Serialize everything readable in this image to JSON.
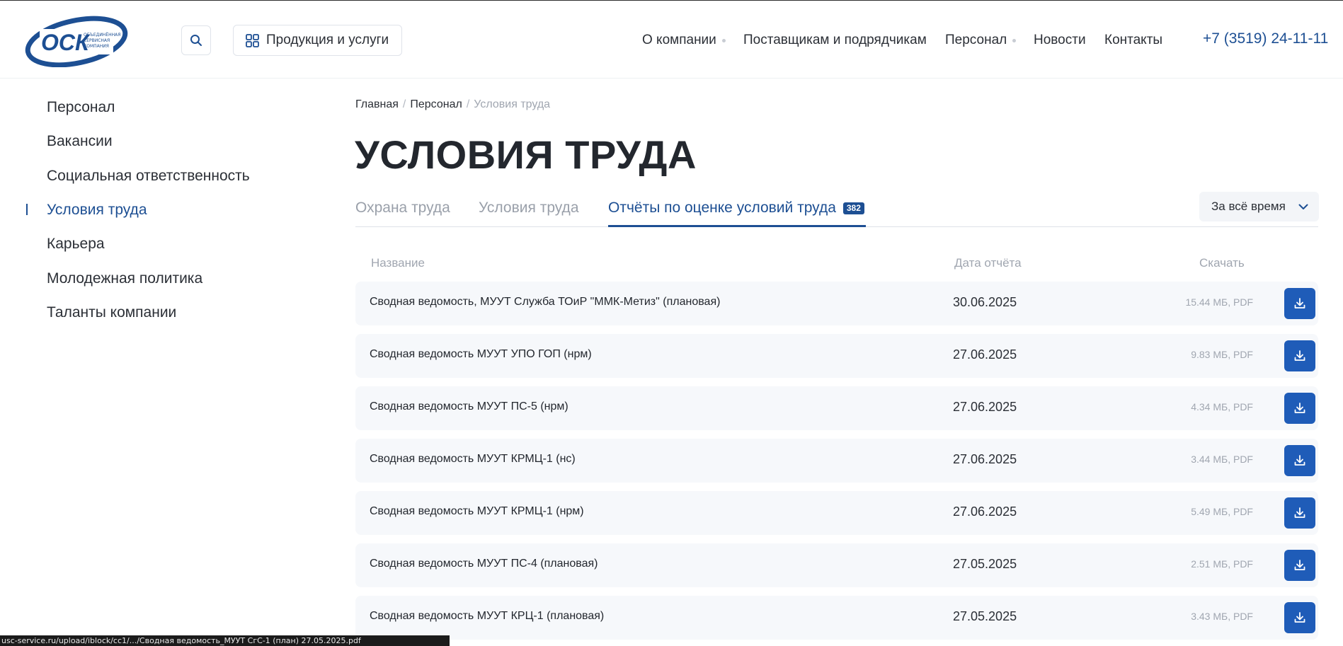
{
  "logo": {
    "abbr": "ОСК",
    "line1": "ОБЪЕДИНЁННАЯ",
    "line2": "СЕРВИСНАЯ",
    "line3": "КОМПАНИЯ",
    "brand_color": "#1d4f93"
  },
  "header": {
    "search_icon": "search-icon",
    "products_label": "Продукция и услуги",
    "products_icon": "grid-icon",
    "nav": [
      {
        "label": "О компании",
        "has_dropdown": true
      },
      {
        "label": "Поставщикам и подрядчикам",
        "has_dropdown": false
      },
      {
        "label": "Персонал",
        "has_dropdown": true
      },
      {
        "label": "Новости",
        "has_dropdown": false
      },
      {
        "label": "Контакты",
        "has_dropdown": false
      }
    ],
    "phone": "+7 (3519) 24-11-11"
  },
  "sidebar": {
    "items": [
      {
        "label": "Персонал",
        "active": false
      },
      {
        "label": "Вакансии",
        "active": false
      },
      {
        "label": "Социальная ответственность",
        "active": false
      },
      {
        "label": "Условия труда",
        "active": true
      },
      {
        "label": "Карьера",
        "active": false
      },
      {
        "label": "Молодежная политика",
        "active": false
      },
      {
        "label": "Таланты компании",
        "active": false
      }
    ]
  },
  "breadcrumb": {
    "items": [
      "Главная",
      "Персонал"
    ],
    "current": "Условия труда",
    "separator": "/"
  },
  "page_title": "УСЛОВИЯ ТРУДА",
  "tabs": [
    {
      "label": "Охрана труда",
      "active": false
    },
    {
      "label": "Условия труда",
      "active": false
    },
    {
      "label": "Отчёты по оценке условий труда",
      "active": true,
      "badge": "382"
    }
  ],
  "period_filter": {
    "value": "За всё время",
    "icon": "chevron-down-icon"
  },
  "table": {
    "columns": {
      "name": "Название",
      "date": "Дата отчёта",
      "download": "Скачать"
    },
    "rows": [
      {
        "name": "Сводная ведомость, МУУТ Служба ТОиР \"ММК-Метиз\" (плановая)",
        "date": "30.06.2025",
        "size": "15.44 МБ, PDF"
      },
      {
        "name": "Сводная ведомость МУУТ УПО ГОП (нрм)",
        "date": "27.06.2025",
        "size": "9.83 МБ, PDF"
      },
      {
        "name": "Сводная ведомость МУУТ ПС-5 (нрм)",
        "date": "27.06.2025",
        "size": "4.34 МБ, PDF"
      },
      {
        "name": "Сводная ведомость МУУТ КРМЦ-1 (нс)",
        "date": "27.06.2025",
        "size": "3.44 МБ, PDF"
      },
      {
        "name": "Сводная ведомость МУУТ КРМЦ-1 (нрм)",
        "date": "27.06.2025",
        "size": "5.49 МБ, PDF"
      },
      {
        "name": "Сводная ведомость МУУТ ПС-4 (плановая)",
        "date": "27.05.2025",
        "size": "2.51 МБ, PDF"
      },
      {
        "name": "Сводная ведомость МУУТ КРЦ-1 (плановая)",
        "date": "27.05.2025",
        "size": "3.43 МБ, PDF"
      }
    ]
  },
  "status_bar": "usc-service.ru/upload/iblock/cc1/.../Сводная ведомость_МУУТ СгС-1 (план) 27.05.2025.pdf"
}
